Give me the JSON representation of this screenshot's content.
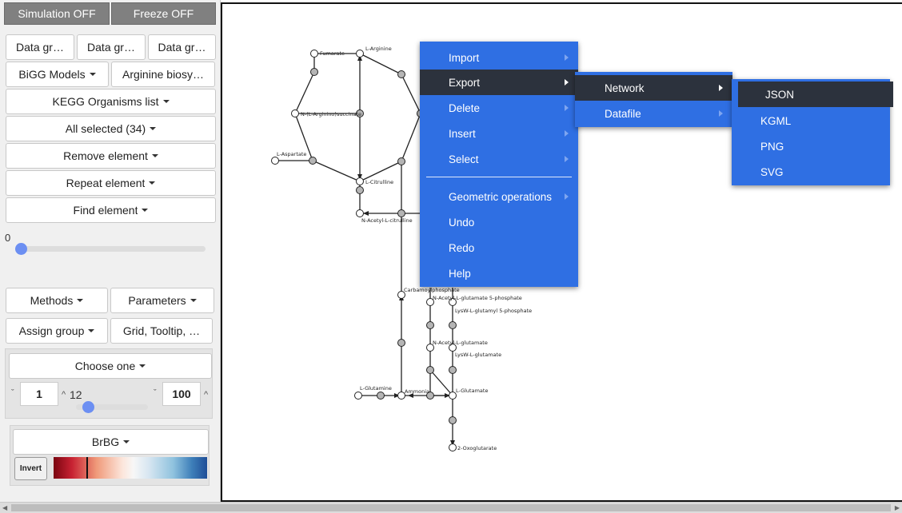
{
  "toggles": {
    "simulation": "Simulation OFF",
    "freeze": "Freeze OFF"
  },
  "data_graph_buttons": [
    "Data gr…",
    "Data gr…",
    "Data gr…"
  ],
  "models": {
    "bigg": "BiGG Models",
    "pathway": "Arginine biosy…"
  },
  "kegg": "KEGG Organisms list",
  "all_selected": "All selected (34)",
  "remove_element": "Remove element",
  "repeat_element": "Repeat element",
  "find_element": "Find element",
  "slider_value": "0",
  "slider_level": 0,
  "methods": "Methods",
  "parameters": "Parameters",
  "assign_group": "Assign group",
  "grid_tooltip": "Grid, Tooltip, …",
  "choose_one": "Choose one",
  "range": {
    "min": "1",
    "current": "12",
    "max": "100",
    "level": 0.11
  },
  "colormap": {
    "name": "BrBG",
    "invert": "Invert"
  },
  "context_menu": {
    "main": [
      "Import",
      "Export",
      "Delete",
      "Insert",
      "Select",
      "Geometric operations",
      "Undo",
      "Redo",
      "Help"
    ],
    "export": [
      "Network",
      "Datafile"
    ],
    "network": [
      "JSON",
      "KGML",
      "PNG",
      "SVG"
    ]
  },
  "graph": {
    "labels": {
      "fumarate": "Fumarate",
      "arginine": "L-Arginine",
      "succinate": "N-(L-Arginino)succinate",
      "aspartate": "L-Aspartate",
      "citrulline": "L-Citrulline",
      "acetyl_citrulline": "N-Acetyl-L-citrulline",
      "carbamoyl": "Carbamoylphosphate",
      "acetyl_glu5p": "N-Acetyl-L-glutamate 5-phosphate",
      "lysw_glu5p": "LysW-L-glutamyl 5-phosphate",
      "acetyl_glu": "N-Acetyl-L-glutamate",
      "lysw_glu": "LysW-L-glutamate",
      "glutamine": "L-Glutamine",
      "ammonia": "Ammonia",
      "glutamate": "L-Glutamate",
      "oxoglutarate": "2-Oxoglutarate"
    }
  },
  "colors": {
    "menu": "#2f6fe3",
    "menu_highlight": "#2c323d",
    "toggle": "#808080",
    "slider_thumb": "#6c8ff2"
  }
}
